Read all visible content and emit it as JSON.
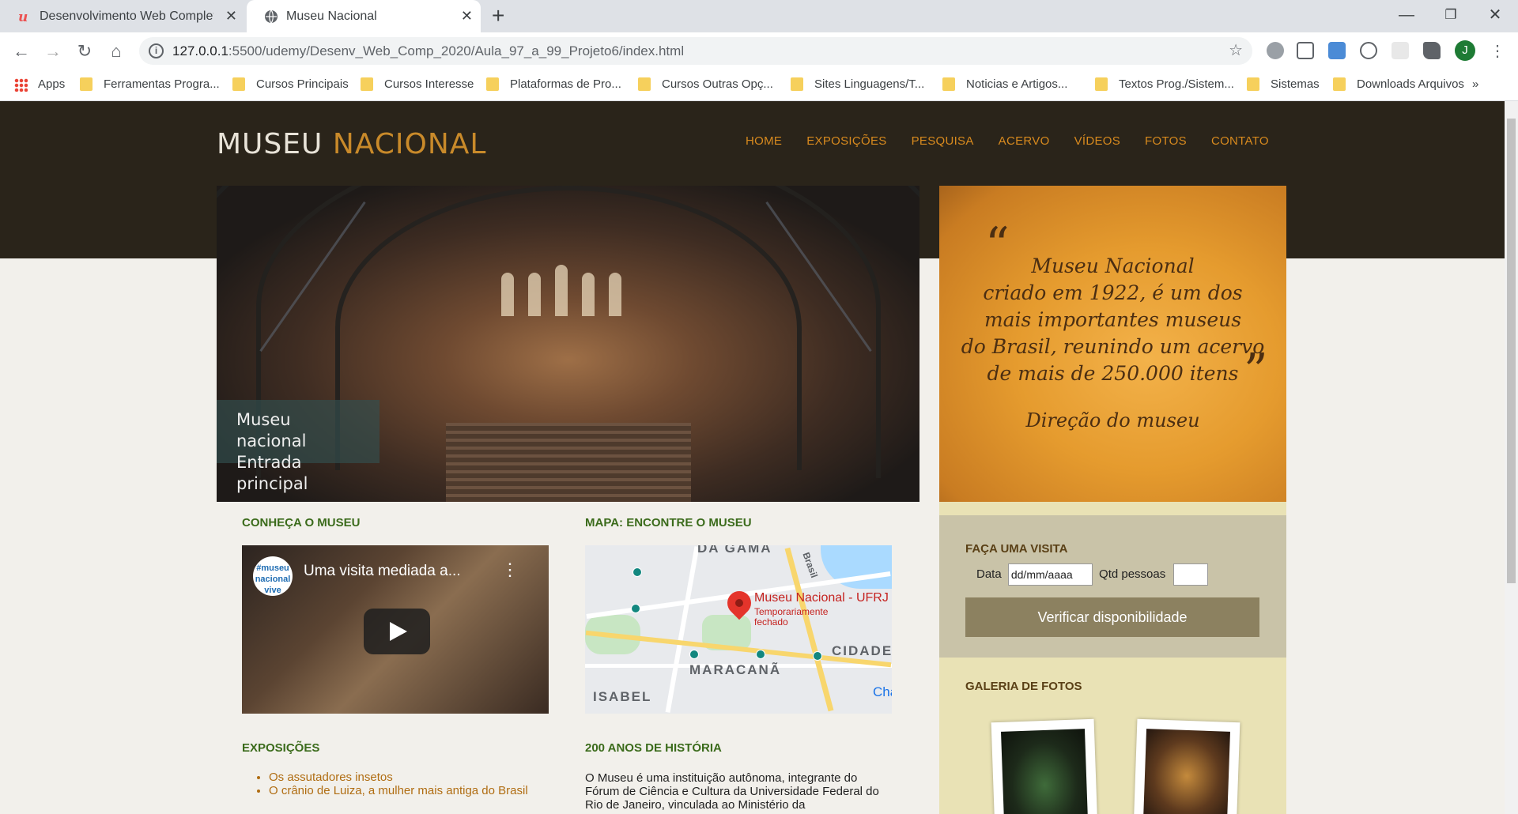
{
  "browser": {
    "tabs": [
      {
        "title": "Desenvolvimento Web Completo",
        "close": "✕"
      },
      {
        "title": "Museu Nacional",
        "close": "✕"
      }
    ],
    "new_tab": "+",
    "window_controls": {
      "minimize": "—",
      "maximize": "❐",
      "close": "✕"
    },
    "url_host": "127.0.0.1",
    "url_path": ":5500/udemy/Desenv_Web_Comp_2020/Aula_97_a_99_Projeto6/index.html",
    "profile_initial": "J",
    "bookmarks": [
      "Apps",
      "Ferramentas Progra...",
      "Cursos Principais",
      "Cursos Interesse",
      "Plataformas de Pro...",
      "Cursos Outras Opç...",
      "Sites Linguagens/T...",
      "Noticias e Artigos...",
      "Textos Prog./Sistem...",
      "Sistemas",
      "Downloads Arquivos"
    ],
    "bookmarks_more": "»"
  },
  "site": {
    "logo_part1": "MUSEU",
    "logo_part2": "NACIONAL",
    "menu": [
      "HOME",
      "EXPOSIÇÕES",
      "PESQUISA",
      "ACERVO",
      "VÍDEOS",
      "FOTOS",
      "CONTATO"
    ],
    "hero_caption_line1": "Museu nacional",
    "hero_caption_line2": "Entrada principal",
    "quote_open": "“",
    "quote_close": "”",
    "quote_lines": [
      "Museu Nacional",
      "criado em 1922, é um dos",
      "mais importantes museus",
      "do Brasil, reunindo um acervo",
      "de mais de 250.000 itens"
    ],
    "quote_author": "Direção do museu",
    "visit_title": "FAÇA UMA VISITA",
    "date_label": "Data",
    "date_placeholder": "dd/mm/aaaa",
    "qtd_label": "Qtd pessoas",
    "verify_button": "Verificar disponibilidade",
    "gallery_title": "GALERIA DE FOTOS",
    "section_museum": "CONHEÇA O MUSEU",
    "section_map": "MAPA: ENCONTRE O MUSEU",
    "video_logo_line1": "#museu",
    "video_logo_line2": "nacional",
    "video_logo_line3": "vive",
    "video_title": "Uma visita mediada a...",
    "map_place": "Museu Nacional - UFRJ",
    "map_status_1": "Temporariamente",
    "map_status_2": "fechado",
    "map_labels": [
      "DA GAMA",
      "MARACANÃ",
      "CIDADE",
      "ISABEL",
      "Brasil",
      "Cha"
    ],
    "section_expo": "EXPOSIÇÕES",
    "expo_items": [
      "Os assutadores insetos",
      "O crânio de Luiza, a mulher mais antiga do Brasil"
    ],
    "section_history": "200 ANOS DE HISTÓRIA",
    "history_text": "O Museu é uma instituição autônoma, integrante do Fórum de Ciência e Cultura da Universidade Federal do Rio de Janeiro, vinculada ao Ministério da"
  },
  "colors": {
    "header_bg": "#2a241a",
    "menu_link": "#d88a1e",
    "section_title": "#3b6b1b",
    "quote_bg": "#e59b2e",
    "visit_bg": "#c9c3a8",
    "button_bg": "#8c8160"
  }
}
